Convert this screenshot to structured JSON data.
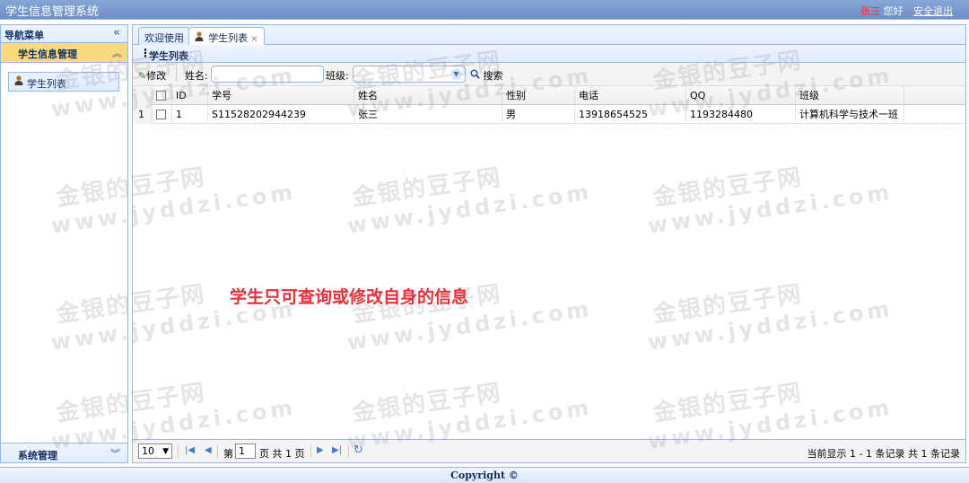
{
  "header": {
    "title": "学生信息管理系统",
    "user_name": "张三",
    "greeting": "您好",
    "logout_label": "安全退出"
  },
  "sidebar": {
    "title": "导航菜单",
    "collapse_glyph": "«",
    "section": {
      "label": "学生信息管理",
      "chevron": "︽"
    },
    "items": [
      {
        "label": "学生列表",
        "icon": "user-icon"
      }
    ],
    "footer": {
      "label": "系统管理",
      "chevron": "︾"
    }
  },
  "tabs": [
    {
      "label": "欢迎使用",
      "active": false
    },
    {
      "label": "学生列表",
      "active": true,
      "close": "×"
    }
  ],
  "panel": {
    "title": "学生列表"
  },
  "toolbar": {
    "edit_label": "修改",
    "name_label": "姓名:",
    "name_value": "",
    "class_label": "班级:",
    "class_value": "",
    "search_label": "搜索"
  },
  "grid": {
    "columns": [
      "ID",
      "学号",
      "姓名",
      "性别",
      "电话",
      "QQ",
      "班级"
    ],
    "rows": [
      {
        "rownum": "1",
        "id": "1",
        "student_no": "S11528202944239",
        "name": "张三",
        "sex": "男",
        "phone": "13918654525",
        "qq": "1193284480",
        "class": "计算机科学与技术一班"
      }
    ]
  },
  "pager": {
    "page_size": "10",
    "page_label": "第",
    "page_value": "1",
    "page_total": "页 共 1 页",
    "info": "当前显示 1 - 1 条记录 共 1 条记录"
  },
  "caption": "学生只可查询或修改自身的信息",
  "watermark": {
    "cn": "金银的豆子网",
    "en": "www.jyddzi.com"
  },
  "footer": {
    "copyright": "Copyright ©"
  },
  "colors": {
    "accent": "#95b8e7",
    "header": "#7395cc",
    "selected": "#fad97f",
    "caption": "#e8303a"
  }
}
